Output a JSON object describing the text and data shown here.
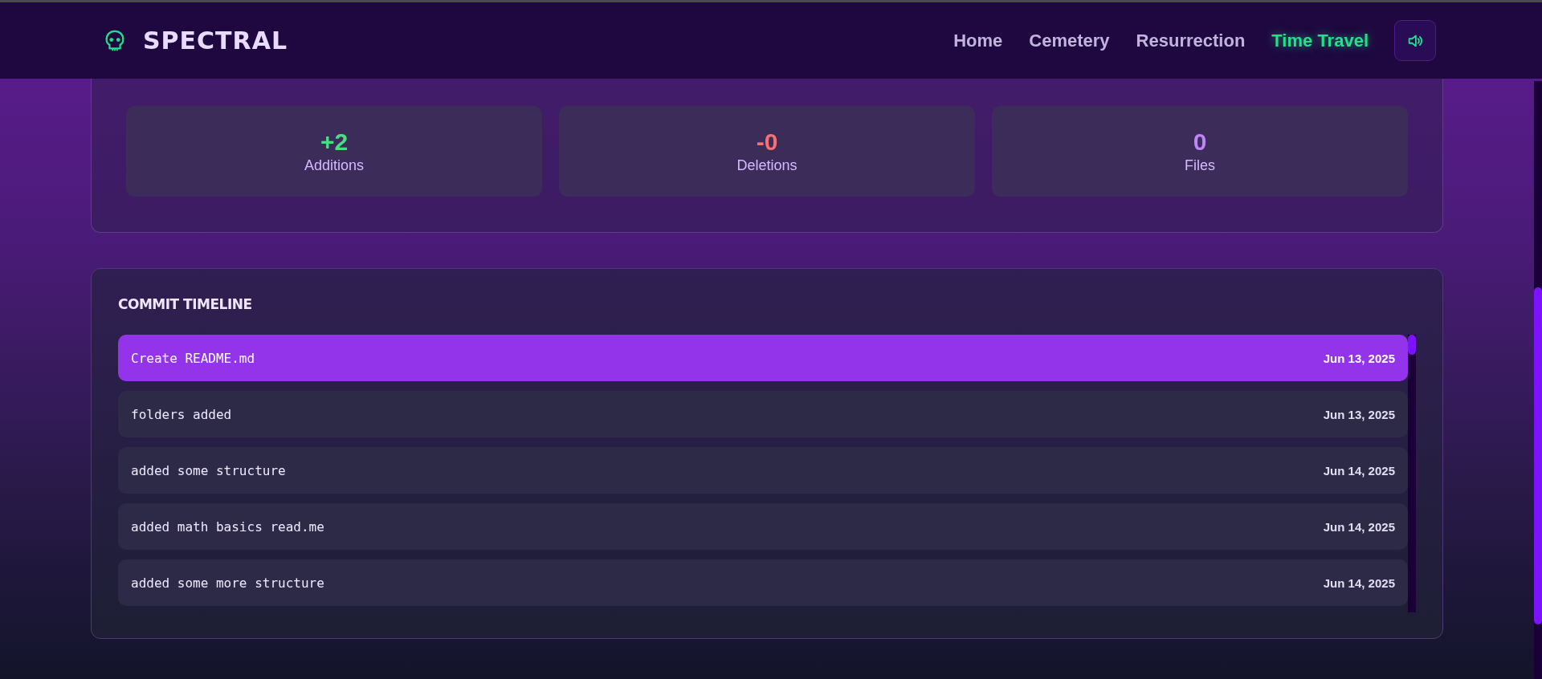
{
  "header": {
    "brand": "SPECTRAL",
    "nav": [
      {
        "label": "Home",
        "selected": false
      },
      {
        "label": "Cemetery",
        "selected": false
      },
      {
        "label": "Resurrection",
        "selected": false
      },
      {
        "label": "Time Travel",
        "selected": true
      }
    ]
  },
  "stats": [
    {
      "value": "+2",
      "label": "Additions",
      "color": "#4ade80"
    },
    {
      "value": "-0",
      "label": "Deletions",
      "color": "#f87171"
    },
    {
      "value": "0",
      "label": "Files",
      "color": "#c084fc"
    }
  ],
  "timeline": {
    "title": "COMMIT TIMELINE",
    "commits": [
      {
        "message": "Create README.md",
        "date": "Jun 13, 2025",
        "selected": true
      },
      {
        "message": "folders added",
        "date": "Jun 13, 2025",
        "selected": false
      },
      {
        "message": "added some structure",
        "date": "Jun 14, 2025",
        "selected": false
      },
      {
        "message": "added math basics read.me",
        "date": "Jun 14, 2025",
        "selected": false
      },
      {
        "message": "added some more structure",
        "date": "Jun 14, 2025",
        "selected": false
      }
    ]
  }
}
